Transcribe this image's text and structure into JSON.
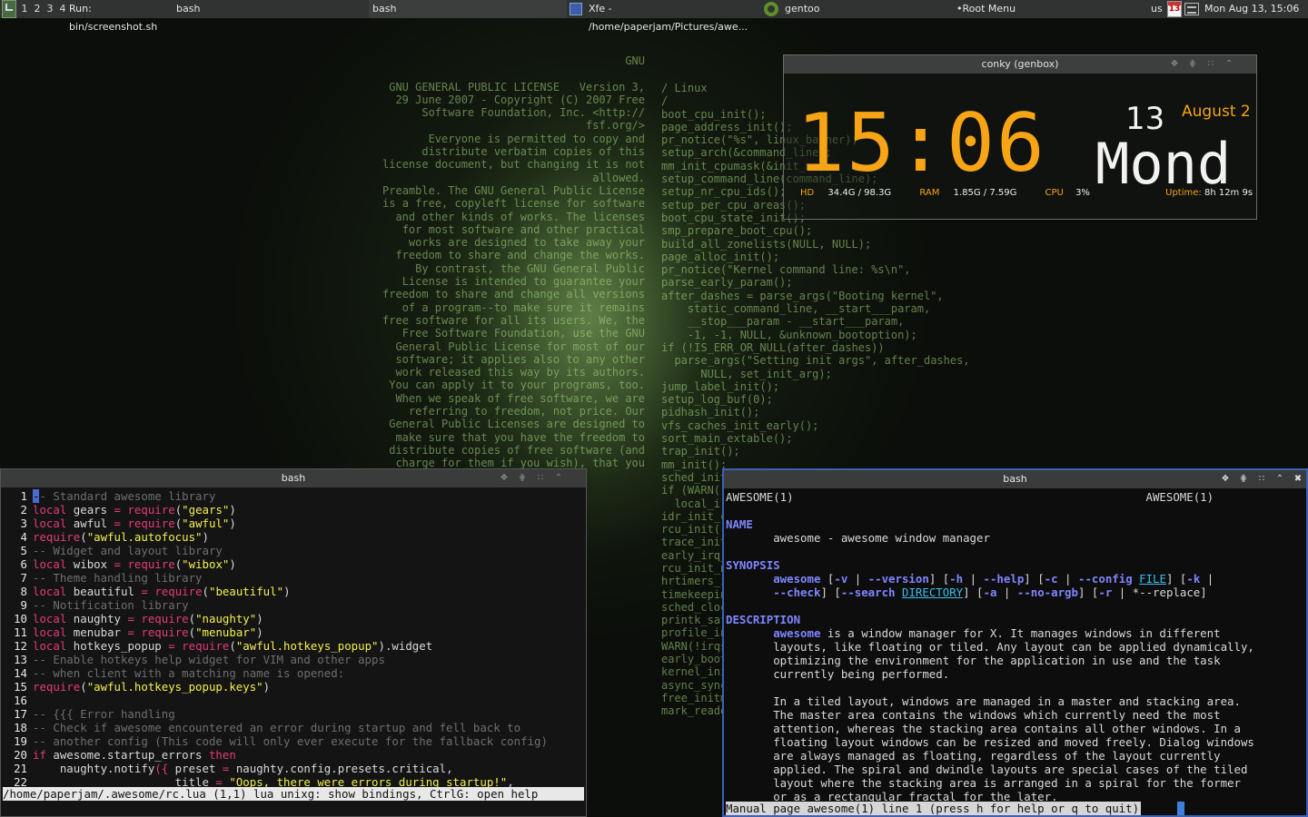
{
  "topbar": {
    "tags": [
      "1",
      "2",
      "3",
      "4"
    ],
    "tasks": [
      {
        "label": "Run: bin/screenshot.sh"
      },
      {
        "label": "bash"
      },
      {
        "label": "bash"
      },
      {
        "label": "Xfe - /home/paperjam/Pictures/awe..."
      },
      {
        "label": "gentoo"
      }
    ],
    "root_menu": "•Root Menu",
    "keyboard_layout": "us",
    "calendar_icon_day": "13",
    "clock": "Mon Aug 13, 15:06"
  },
  "wallpaper": {
    "left_text": "GNU\n\nGNU GENERAL PUBLIC LICENSE   Version 3,\n29 June 2007 - Copyright (C) 2007 Free\nSoftware Foundation, Inc. <http://\nfsf.org/>\nEveryone is permitted to copy and\ndistribute verbatim copies of this\nlicense document, but changing it is not\nallowed.\nPreamble. The GNU General Public License\nis a free, copyleft license for software\nand other kinds of works. The licenses\nfor most software and other practical\nworks are designed to take away your\nfreedom to share and change the works.\nBy contrast, the GNU General Public\nLicense is intended to guarantee your\nfreedom to share and change all versions\nof a program--to make sure it remains\nfree software for all its users. We, the\nFree Software Foundation, use the GNU\nGeneral Public License for most of our\nsoftware; it applies also to any other\nwork released this way by its authors.\nYou can apply it to your programs, too.\nWhen we speak of free software, we are\nreferring to freedom, not price. Our\nGeneral Public Licenses are designed to\nmake sure that you have the freedom to\ndistribute copies of free software (and\ncharge for them if you wish), that you",
    "right_text": "/ Linux\n/\nboot_cpu_init();\npage_address_init();\npr_notice(\"%s\", linux_banner);\nsetup_arch(&command_line);\nmm_init_cpumask(&init_mm);\nsetup_command_line(command_line);\nsetup_nr_cpu_ids();\nsetup_per_cpu_areas();\nboot_cpu_state_init();\nsmp_prepare_boot_cpu();\nbuild_all_zonelists(NULL, NULL);\npage_alloc_init();\npr_notice(\"Kernel command line: %s\\n\",\nparse_early_param();\nafter_dashes = parse_args(\"Booting kernel\",\n    static_command_line, __start___param,\n    __stop___param - __start___param,\n    -1, -1, NULL, &unknown_bootoption);\nif (!IS_ERR_OR_NULL(after_dashes))\n  parse_args(\"Setting init args\", after_dashes,\n      NULL, set_init_arg);\njump_label_init();\nsetup_log_buf(0);\npidhash_init();\nvfs_caches_init_early();\nsort_main_extable();\ntrap_init();\nmm_init();\nsched_init();\nif (WARN(!irqs_disabled(),\n  local_irq_disable();\nidr_init_cache();\nrcu_init();\ntrace_init();\nearly_irq_init();\nrcu_init_nohz();\nhrtimers_init();\ntimekeeping_init();\nsched_clock_postinit();\nprintk_safe_init();\nprofile_init();\nWARN(!irqs_disabled(),\nearly_boot_irqs_disabled\nkernel_init_freeable();\nasync_synchronize_full();\nfree_initmem();\nmark_readonly();"
  },
  "conky": {
    "title": "conky (genbox)",
    "time": "15:06",
    "day": "13",
    "month": "August 2",
    "weekday": "Mond",
    "hd_label": "HD",
    "hd_value": "34.4G / 98.3G",
    "ram_label": "RAM",
    "ram_value": "1.85G / 7.59G",
    "cpu_label": "CPU",
    "cpu_value": "3%",
    "uptime_label": "Uptime:",
    "uptime_value": "8h 12m 9s",
    "accent_color": "#f7a415"
  },
  "term_left": {
    "title": "bash",
    "status_line": "/home/paperjam/.awesome/rc.lua (1,1) lua unixg: show bindings, CtrlG: open help"
  },
  "term_right": {
    "title": "bash",
    "status_line": "Manual page awesome(1) line 1 (press h for help or q to quit)"
  },
  "vim_lines": [
    [
      {
        "t": "1",
        "c": "ln"
      },
      {
        "t": "-",
        "c": "cur"
      },
      {
        "t": "- Standard awesome library",
        "c": "c"
      }
    ],
    [
      {
        "t": "2",
        "c": "ln"
      },
      {
        "t": "local",
        "c": "k"
      },
      {
        "t": " gears ",
        "c": ""
      },
      {
        "t": "=",
        "c": "k"
      },
      {
        "t": " ",
        "c": ""
      },
      {
        "t": "require",
        "c": "k"
      },
      {
        "t": "(",
        "c": ""
      },
      {
        "t": "\"gears\"",
        "c": "s"
      },
      {
        "t": ")",
        "c": ""
      }
    ],
    [
      {
        "t": "3",
        "c": "ln"
      },
      {
        "t": "local",
        "c": "k"
      },
      {
        "t": " awful ",
        "c": ""
      },
      {
        "t": "=",
        "c": "k"
      },
      {
        "t": " ",
        "c": ""
      },
      {
        "t": "require",
        "c": "k"
      },
      {
        "t": "(",
        "c": ""
      },
      {
        "t": "\"awful\"",
        "c": "s"
      },
      {
        "t": ")",
        "c": ""
      }
    ],
    [
      {
        "t": "4",
        "c": "ln"
      },
      {
        "t": "require",
        "c": "k"
      },
      {
        "t": "(",
        "c": ""
      },
      {
        "t": "\"awful.autofocus\"",
        "c": "s"
      },
      {
        "t": ")",
        "c": ""
      }
    ],
    [
      {
        "t": "5",
        "c": "ln"
      },
      {
        "t": "-- Widget and layout library",
        "c": "c"
      }
    ],
    [
      {
        "t": "6",
        "c": "ln"
      },
      {
        "t": "local",
        "c": "k"
      },
      {
        "t": " wibox ",
        "c": ""
      },
      {
        "t": "=",
        "c": "k"
      },
      {
        "t": " ",
        "c": ""
      },
      {
        "t": "require",
        "c": "k"
      },
      {
        "t": "(",
        "c": ""
      },
      {
        "t": "\"wibox\"",
        "c": "s"
      },
      {
        "t": ")",
        "c": ""
      }
    ],
    [
      {
        "t": "7",
        "c": "ln"
      },
      {
        "t": "-- Theme handling library",
        "c": "c"
      }
    ],
    [
      {
        "t": "8",
        "c": "ln"
      },
      {
        "t": "local",
        "c": "k"
      },
      {
        "t": " beautiful ",
        "c": ""
      },
      {
        "t": "=",
        "c": "k"
      },
      {
        "t": " ",
        "c": ""
      },
      {
        "t": "require",
        "c": "k"
      },
      {
        "t": "(",
        "c": ""
      },
      {
        "t": "\"beautiful\"",
        "c": "s"
      },
      {
        "t": ")",
        "c": ""
      }
    ],
    [
      {
        "t": "9",
        "c": "ln"
      },
      {
        "t": "-- Notification library",
        "c": "c"
      }
    ],
    [
      {
        "t": "10",
        "c": "ln"
      },
      {
        "t": "local",
        "c": "k"
      },
      {
        "t": " naughty ",
        "c": ""
      },
      {
        "t": "=",
        "c": "k"
      },
      {
        "t": " ",
        "c": ""
      },
      {
        "t": "require",
        "c": "k"
      },
      {
        "t": "(",
        "c": ""
      },
      {
        "t": "\"naughty\"",
        "c": "s"
      },
      {
        "t": ")",
        "c": ""
      }
    ],
    [
      {
        "t": "11",
        "c": "ln"
      },
      {
        "t": "local",
        "c": "k"
      },
      {
        "t": " menubar ",
        "c": ""
      },
      {
        "t": "=",
        "c": "k"
      },
      {
        "t": " ",
        "c": ""
      },
      {
        "t": "require",
        "c": "k"
      },
      {
        "t": "(",
        "c": ""
      },
      {
        "t": "\"menubar\"",
        "c": "s"
      },
      {
        "t": ")",
        "c": ""
      }
    ],
    [
      {
        "t": "12",
        "c": "ln"
      },
      {
        "t": "local",
        "c": "k"
      },
      {
        "t": " hotkeys_popup ",
        "c": ""
      },
      {
        "t": "=",
        "c": "k"
      },
      {
        "t": " ",
        "c": ""
      },
      {
        "t": "require",
        "c": "k"
      },
      {
        "t": "(",
        "c": ""
      },
      {
        "t": "\"awful.hotkeys_popup\"",
        "c": "s"
      },
      {
        "t": ").widget",
        "c": ""
      }
    ],
    [
      {
        "t": "13",
        "c": "ln"
      },
      {
        "t": "-- Enable hotkeys help widget for VIM and other apps",
        "c": "c"
      }
    ],
    [
      {
        "t": "14",
        "c": "ln"
      },
      {
        "t": "-- when client with a matching name is opened:",
        "c": "c"
      }
    ],
    [
      {
        "t": "15",
        "c": "ln"
      },
      {
        "t": "require",
        "c": "k"
      },
      {
        "t": "(",
        "c": ""
      },
      {
        "t": "\"awful.hotkeys_popup.keys\"",
        "c": "s"
      },
      {
        "t": ")",
        "c": ""
      }
    ],
    [
      {
        "t": "16",
        "c": "ln"
      }
    ],
    [
      {
        "t": "17",
        "c": "ln"
      },
      {
        "t": "-- {{{ Error handling",
        "c": "c"
      }
    ],
    [
      {
        "t": "18",
        "c": "ln"
      },
      {
        "t": "-- Check if awesome encountered an error during startup and fell back to",
        "c": "c"
      }
    ],
    [
      {
        "t": "19",
        "c": "ln"
      },
      {
        "t": "-- another config (This code will only ever execute for the fallback config)",
        "c": "c"
      }
    ],
    [
      {
        "t": "20",
        "c": "ln"
      },
      {
        "t": "if",
        "c": "k"
      },
      {
        "t": " awesome.startup_errors ",
        "c": ""
      },
      {
        "t": "then",
        "c": "k"
      }
    ],
    [
      {
        "t": "21",
        "c": "ln"
      },
      {
        "t": "    naughty.notify",
        "c": ""
      },
      {
        "t": "({",
        "c": "k"
      },
      {
        "t": " preset ",
        "c": ""
      },
      {
        "t": "=",
        "c": "k"
      },
      {
        "t": " naughty.config.presets.critical,",
        "c": ""
      }
    ],
    [
      {
        "t": "22",
        "c": "ln"
      },
      {
        "t": "                     title ",
        "c": ""
      },
      {
        "t": "=",
        "c": "k"
      },
      {
        "t": " ",
        "c": ""
      },
      {
        "t": "\"Oops, there were errors during startup!\"",
        "c": "s"
      },
      {
        "t": ",",
        "c": ""
      }
    ]
  ],
  "man_lines": [
    [
      {
        "t": "AWESOME(1)                                                    AWESOME(1)",
        "c": ""
      }
    ],
    [],
    [
      {
        "t": "NAME",
        "c": "mh"
      }
    ],
    [
      {
        "t": "       awesome - awesome window manager",
        "c": ""
      }
    ],
    [],
    [
      {
        "t": "SYNOPSIS",
        "c": "mh"
      }
    ],
    [
      {
        "t": "       ",
        "c": ""
      },
      {
        "t": "awesome",
        "c": "mb"
      },
      {
        "t": " [",
        "c": ""
      },
      {
        "t": "-v",
        "c": "mb"
      },
      {
        "t": " | ",
        "c": ""
      },
      {
        "t": "--version",
        "c": "mb"
      },
      {
        "t": "] [",
        "c": ""
      },
      {
        "t": "-h",
        "c": "mb"
      },
      {
        "t": " | ",
        "c": ""
      },
      {
        "t": "--help",
        "c": "mb"
      },
      {
        "t": "] [",
        "c": ""
      },
      {
        "t": "-c",
        "c": "mb"
      },
      {
        "t": " | ",
        "c": ""
      },
      {
        "t": "--config",
        "c": "mb"
      },
      {
        "t": " ",
        "c": ""
      },
      {
        "t": "FILE",
        "c": "mu"
      },
      {
        "t": "] [",
        "c": ""
      },
      {
        "t": "-k",
        "c": "mb"
      },
      {
        "t": " |",
        "c": ""
      }
    ],
    [
      {
        "t": "       ",
        "c": ""
      },
      {
        "t": "--check",
        "c": "mb"
      },
      {
        "t": "] [",
        "c": ""
      },
      {
        "t": "--search",
        "c": "mb"
      },
      {
        "t": " ",
        "c": ""
      },
      {
        "t": "DIRECTORY",
        "c": "mu"
      },
      {
        "t": "] [",
        "c": ""
      },
      {
        "t": "-a",
        "c": "mb"
      },
      {
        "t": " | ",
        "c": ""
      },
      {
        "t": "--no-argb",
        "c": "mb"
      },
      {
        "t": "] [",
        "c": ""
      },
      {
        "t": "-r",
        "c": "mb"
      },
      {
        "t": " | *--replace]",
        "c": ""
      }
    ],
    [],
    [
      {
        "t": "DESCRIPTION",
        "c": "mh"
      }
    ],
    [
      {
        "t": "       ",
        "c": ""
      },
      {
        "t": "awesome",
        "c": "mb"
      },
      {
        "t": " is a window manager for X. It manages windows in different",
        "c": ""
      }
    ],
    [
      {
        "t": "       layouts, like floating or tiled. Any layout can be applied dynamically,",
        "c": ""
      }
    ],
    [
      {
        "t": "       optimizing the environment for the application in use and the task",
        "c": ""
      }
    ],
    [
      {
        "t": "       currently being performed.",
        "c": ""
      }
    ],
    [],
    [
      {
        "t": "       In a tiled layout, windows are managed in a master and stacking area.",
        "c": ""
      }
    ],
    [
      {
        "t": "       The master area contains the windows which currently need the most",
        "c": ""
      }
    ],
    [
      {
        "t": "       attention, whereas the stacking area contains all other windows. In a",
        "c": ""
      }
    ],
    [
      {
        "t": "       floating layout windows can be resized and moved freely. Dialog windows",
        "c": ""
      }
    ],
    [
      {
        "t": "       are always managed as floating, regardless of the layout currently",
        "c": ""
      }
    ],
    [
      {
        "t": "       applied. The spiral and dwindle layouts are special cases of the tiled",
        "c": ""
      }
    ],
    [
      {
        "t": "       layout where the stacking area is arranged in a spiral for the former",
        "c": ""
      }
    ],
    [
      {
        "t": "       or as a rectangular fractal for the later.",
        "c": ""
      }
    ]
  ]
}
